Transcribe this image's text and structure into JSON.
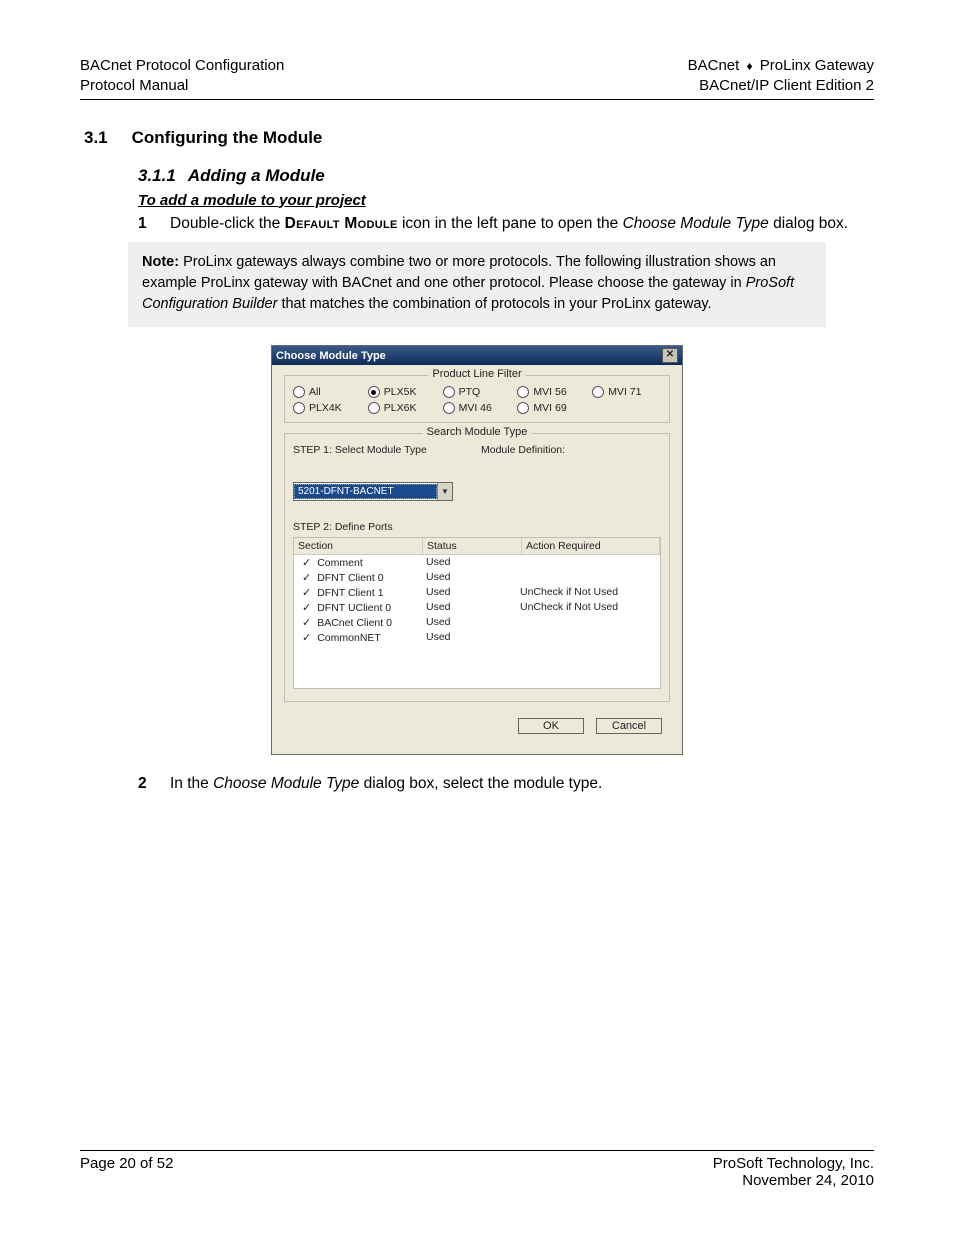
{
  "header": {
    "left1": "BACnet Protocol Configuration",
    "left2": "Protocol Manual",
    "right1a": "BACnet ",
    "right1b": " ProLinx Gateway",
    "right2": "BACnet/IP Client Edition 2"
  },
  "section": {
    "num": "3.1",
    "title": "Configuring the Module"
  },
  "subsection": {
    "num": "3.1.1",
    "title": "Adding a Module"
  },
  "instr_title": "To add a module to your project",
  "step1": {
    "num": "1",
    "pre": "Double-click the ",
    "scaps": "Default Module",
    "mid": " icon in the left pane to open the ",
    "ital": "Choose Module Type",
    "post": " dialog box."
  },
  "note": {
    "label": "Note:",
    "body_pre": " ProLinx gateways always combine two or more protocols. The following illustration shows an example ProLinx gateway with BACnet and one other protocol. Please choose the gateway in ",
    "ital": "ProSoft Configuration Builder",
    "body_post": " that matches the combination of protocols in your ProLinx gateway."
  },
  "dialog": {
    "title": "Choose Module Type",
    "filter_legend": "Product Line Filter",
    "radios": [
      {
        "label": "All",
        "sel": false
      },
      {
        "label": "PLX5K",
        "sel": true
      },
      {
        "label": "PTQ",
        "sel": false
      },
      {
        "label": "MVI 56",
        "sel": false
      },
      {
        "label": "MVI 71",
        "sel": false
      },
      {
        "label": "PLX4K",
        "sel": false
      },
      {
        "label": "PLX6K",
        "sel": false
      },
      {
        "label": "MVI 46",
        "sel": false
      },
      {
        "label": "MVI 69",
        "sel": false
      }
    ],
    "search_legend": "Search Module Type",
    "step1_label": "STEP 1: Select Module Type",
    "module_def_label": "Module Definition:",
    "combo_value": "5201-DFNT-BACNET",
    "step2_label": "STEP 2: Define Ports",
    "cols": {
      "section": "Section",
      "status": "Status",
      "action": "Action Required"
    },
    "rows": [
      {
        "section": "Comment",
        "status": "Used",
        "action": ""
      },
      {
        "section": "DFNT Client 0",
        "status": "Used",
        "action": ""
      },
      {
        "section": "DFNT Client 1",
        "status": "Used",
        "action": "UnCheck if Not Used"
      },
      {
        "section": "DFNT UClient 0",
        "status": "Used",
        "action": "UnCheck if Not Used"
      },
      {
        "section": "BACnet Client 0",
        "status": "Used",
        "action": ""
      },
      {
        "section": "CommonNET",
        "status": "Used",
        "action": ""
      }
    ],
    "ok": "OK",
    "cancel": "Cancel"
  },
  "step2": {
    "num": "2",
    "pre": "In the ",
    "ital": "Choose Module Type",
    "post": " dialog box, select the module type."
  },
  "footer": {
    "left": "Page 20 of 52",
    "right1": "ProSoft Technology, Inc.",
    "right2": "November 24, 2010"
  }
}
